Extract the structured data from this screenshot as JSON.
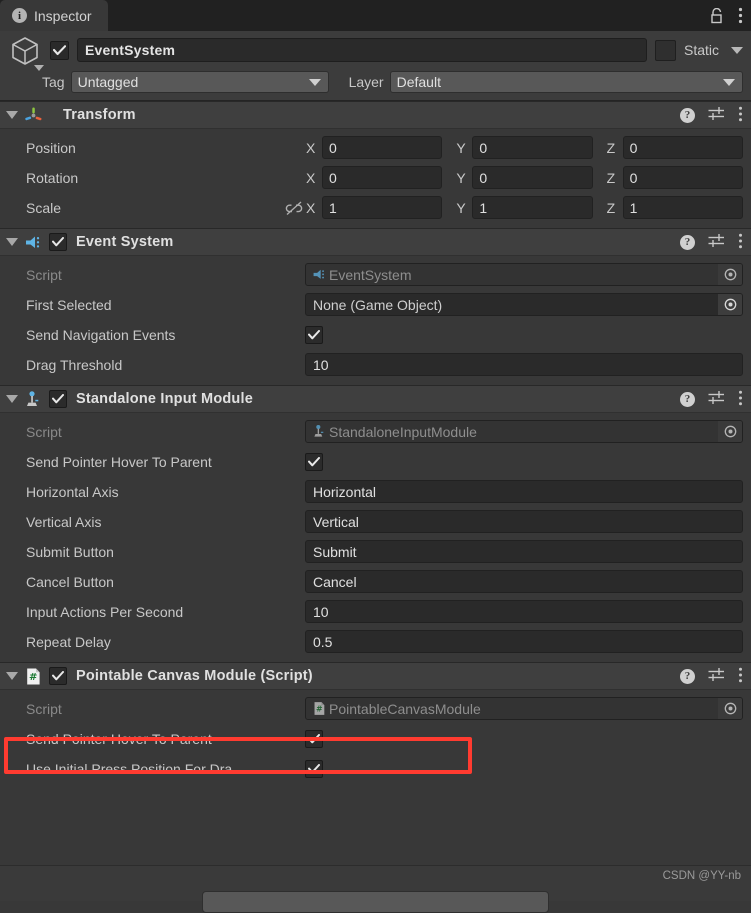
{
  "window": {
    "tab_label": "Inspector",
    "tab_icon": "info-icon",
    "lock_icon": "lock-icon",
    "menu_icon": "kebab-menu-icon"
  },
  "gameobject": {
    "icon": "cube-icon",
    "enabled": true,
    "name": "EventSystem",
    "static_label": "Static",
    "static_checked": false,
    "tag_label": "Tag",
    "tag_value": "Untagged",
    "layer_label": "Layer",
    "layer_value": "Default"
  },
  "components": [
    {
      "title": "Transform",
      "icon": "transform-gizmo-icon",
      "has_checkbox": false,
      "expanded": true,
      "rows": [
        {
          "type": "vector3",
          "label": "Position",
          "axes": [
            "X",
            "Y",
            "Z"
          ],
          "values": [
            "0",
            "0",
            "0"
          ],
          "link": false
        },
        {
          "type": "vector3",
          "label": "Rotation",
          "axes": [
            "X",
            "Y",
            "Z"
          ],
          "values": [
            "0",
            "0",
            "0"
          ],
          "link": false
        },
        {
          "type": "vector3",
          "label": "Scale",
          "axes": [
            "X",
            "Y",
            "Z"
          ],
          "values": [
            "1",
            "1",
            "1"
          ],
          "link": true,
          "link_icon": "broken-link-icon"
        }
      ]
    },
    {
      "title": "Event System",
      "icon": "event-system-icon",
      "has_checkbox": true,
      "checked": true,
      "expanded": true,
      "rows": [
        {
          "type": "object",
          "label": "Script",
          "value": "EventSystem",
          "icon": "event-system-icon",
          "disabled": true
        },
        {
          "type": "object",
          "label": "First Selected",
          "value": "None (Game Object)",
          "icon": null,
          "disabled": false
        },
        {
          "type": "checkbox",
          "label": "Send Navigation Events",
          "checked": true
        },
        {
          "type": "text",
          "label": "Drag Threshold",
          "value": "10"
        }
      ]
    },
    {
      "title": "Standalone Input Module",
      "icon": "joystick-icon",
      "has_checkbox": true,
      "checked": true,
      "expanded": true,
      "rows": [
        {
          "type": "object",
          "label": "Script",
          "value": "StandaloneInputModule",
          "icon": "joystick-icon",
          "disabled": true
        },
        {
          "type": "checkbox",
          "label": "Send Pointer Hover To Parent",
          "checked": true
        },
        {
          "type": "text",
          "label": "Horizontal Axis",
          "value": "Horizontal"
        },
        {
          "type": "text",
          "label": "Vertical Axis",
          "value": "Vertical"
        },
        {
          "type": "text",
          "label": "Submit Button",
          "value": "Submit"
        },
        {
          "type": "text",
          "label": "Cancel Button",
          "value": "Cancel"
        },
        {
          "type": "text",
          "label": "Input Actions Per Second",
          "value": "10"
        },
        {
          "type": "text",
          "label": "Repeat Delay",
          "value": "0.5"
        }
      ]
    },
    {
      "title": "Pointable Canvas Module (Script)",
      "icon": "csharp-script-icon",
      "has_checkbox": true,
      "checked": true,
      "expanded": true,
      "highlighted": true,
      "rows": [
        {
          "type": "object",
          "label": "Script",
          "value": "PointableCanvasModule",
          "icon": "csharp-script-icon",
          "disabled": true
        },
        {
          "type": "checkbox",
          "label": "Send Pointer Hover To Parent",
          "checked": true
        },
        {
          "type": "checkbox",
          "label": "Use Initial Press Position For Dra",
          "checked": true
        }
      ]
    }
  ],
  "footer": {
    "watermark": "CSDN @YY-nb"
  },
  "colors": {
    "highlight": "#ff3b30",
    "panel_bg": "#383838",
    "header_bg": "#3f3f3f",
    "field_bg": "#2a2a2a",
    "accent_blue": "#5fb4e5"
  }
}
